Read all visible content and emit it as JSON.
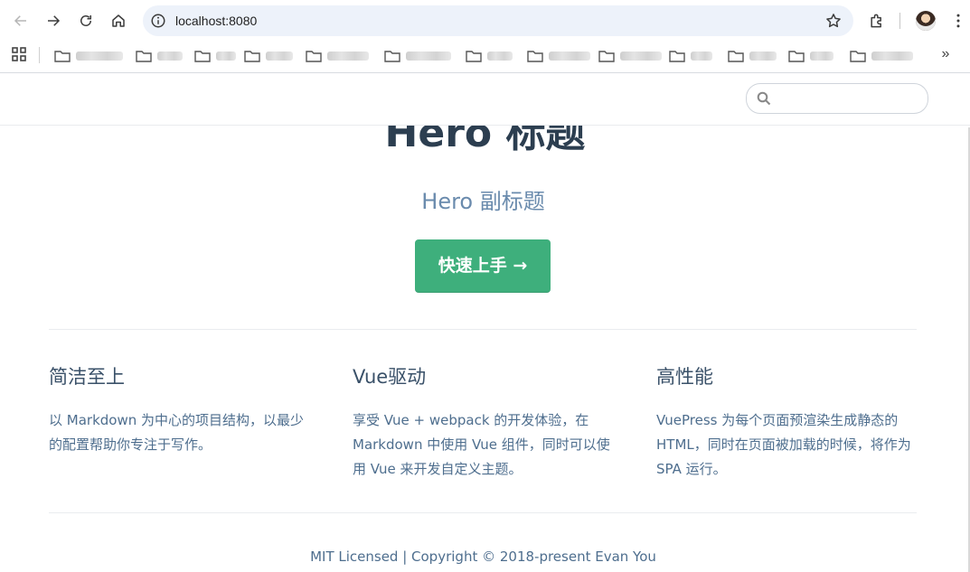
{
  "browser": {
    "url": "localhost:8080",
    "bookmarks_more": "»",
    "icons": [
      "back-icon",
      "forward-icon",
      "reload-icon",
      "home-icon",
      "site-info-icon",
      "bookmark-star-icon",
      "extensions-icon",
      "profile-avatar",
      "menu-kebab-icon",
      "apps-grid-icon",
      "folder-icon"
    ]
  },
  "site": {
    "search_placeholder": "",
    "hero": {
      "title": "Hero 标题",
      "description": "Hero 副标题",
      "action": "快速上手 →"
    },
    "features": [
      {
        "title": "简洁至上",
        "details": "以 Markdown 为中心的项目结构，以最少的配置帮助你专注于写作。"
      },
      {
        "title": "Vue驱动",
        "details": "享受 Vue + webpack 的开发体验，在 Markdown 中使用 Vue 组件，同时可以使用 Vue 来开发自定义主题。"
      },
      {
        "title": "高性能",
        "details": "VuePress 为每个页面预渲染生成静态的 HTML，同时在页面被加载的时候，将作为 SPA 运行。"
      }
    ],
    "footer": "MIT Licensed | Copyright © 2018-present Evan You"
  },
  "colors": {
    "accent": "#3eaf7c",
    "text": "#2c3e50",
    "muted": "#6a8bad",
    "omnibox_bg": "#edf2fa"
  }
}
